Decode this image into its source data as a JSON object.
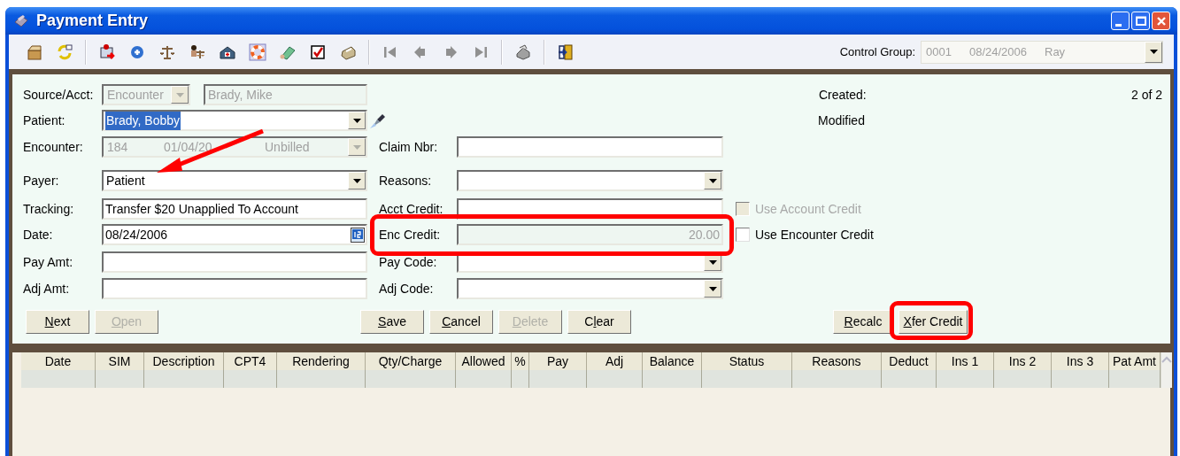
{
  "window": {
    "title": "Payment Entry"
  },
  "control_group": {
    "label": "Control Group:",
    "values": [
      "0001",
      "08/24/2006",
      "Ray"
    ],
    "disabled": true
  },
  "form": {
    "rows": [
      {
        "left": {
          "label": "Source/Acct:",
          "field": {
            "kind": "source",
            "combo": {
              "value": "Encounter",
              "disabled": true
            },
            "text": {
              "value": "Brady, Mike",
              "disabled": true
            }
          }
        },
        "info": {
          "label": "Created:",
          "extra": "2 of 2"
        }
      },
      {
        "left": {
          "label": "Patient:",
          "field": {
            "kind": "combo",
            "value": "Brady, Bobby",
            "disabled": false,
            "selected": true,
            "lookup": true
          }
        },
        "info": {
          "label": "Modified"
        }
      },
      {
        "left": {
          "label": "Encounter:",
          "field": {
            "kind": "multicombo",
            "values": [
              "184",
              "01/04/20",
              "Unbilled"
            ],
            "disabled": true
          }
        },
        "right": {
          "label": "Claim Nbr:",
          "field": {
            "kind": "text",
            "disabled": false
          }
        }
      },
      {
        "left": {
          "label": "Payer:",
          "field": {
            "kind": "combo",
            "value": "Patient",
            "disabled": false,
            "selected": false
          }
        },
        "right": {
          "label": "Reasons:",
          "field": {
            "kind": "combo",
            "disabled": false
          }
        }
      },
      {
        "left": {
          "label": "Tracking:",
          "field": {
            "kind": "text",
            "value": "Transfer $20 Unapplied To Account",
            "disabled": false
          }
        },
        "right": {
          "label": "Acct Credit:",
          "field": {
            "kind": "text",
            "disabled": false
          }
        },
        "checkbox": {
          "label": "Use Account Credit",
          "checked": false,
          "disabled": true
        }
      },
      {
        "left": {
          "label": "Date:",
          "field": {
            "kind": "date",
            "value": "08/24/2006"
          }
        },
        "right": {
          "label": "Enc Credit:",
          "field": {
            "kind": "amount",
            "value": "20.00",
            "disabled": true
          }
        },
        "checkbox": {
          "label": "Use Encounter Credit",
          "checked": false,
          "disabled": false
        }
      },
      {
        "left": {
          "label": "Pay Amt:",
          "field": {
            "kind": "text",
            "disabled": false
          }
        },
        "right": {
          "label": "Pay Code:",
          "field": {
            "kind": "combo",
            "disabled": false
          }
        }
      },
      {
        "left": {
          "label": "Adj Amt:",
          "field": {
            "kind": "text",
            "disabled": false
          }
        },
        "right": {
          "label": "Adj Code:",
          "field": {
            "kind": "combo",
            "disabled": false
          }
        }
      }
    ]
  },
  "buttons": {
    "left": [
      {
        "access_key": "N",
        "label_rest": "ext",
        "disabled": false
      },
      {
        "access_key": "O",
        "label_rest": "pen",
        "disabled": true
      }
    ],
    "middle": [
      {
        "access_key": "S",
        "label_rest": "ave",
        "disabled": false
      },
      {
        "access_key": "C",
        "label_rest": "ancel",
        "disabled": false
      },
      {
        "access_key": "D",
        "label_rest": "elete",
        "disabled": true
      },
      {
        "label_start": "C",
        "access_key": "l",
        "label_rest": "ear",
        "disabled": false
      }
    ],
    "right": [
      {
        "access_key": "R",
        "label_rest": "ecalc",
        "disabled": false
      },
      {
        "access_key": "X",
        "label_rest": "fer Credit",
        "disabled": false
      }
    ]
  },
  "table": {
    "columns": [
      "Date",
      "SIM",
      "Description",
      "CPT4",
      "Rendering",
      "Qty/Charge",
      "Allowed",
      "%",
      "Pay",
      "Adj",
      "Balance",
      "Status",
      "Reasons",
      "Deduct",
      "Ins 1",
      "Ins 2",
      "Ins 3",
      "Pat Amt"
    ]
  }
}
